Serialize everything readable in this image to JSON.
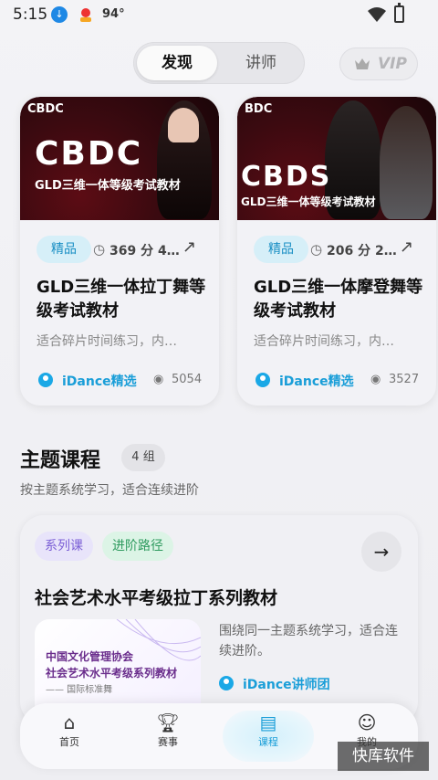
{
  "status": {
    "time": "5:15",
    "temp": "94°"
  },
  "tabs": {
    "active": "发现",
    "inactive": "讲师",
    "vip": "VIP"
  },
  "cards": [
    {
      "brand": "CBDC",
      "big_text": "CBDC",
      "image_subtitle": "GLD三维一体等级考试教材",
      "tag": "精品",
      "duration": "369 分 4…",
      "title": "GLD三维一体拉丁舞等级考试教材",
      "desc": "适合碎片时间练习，内…",
      "author": "iDance精选",
      "views": "5054"
    },
    {
      "brand": "BDC",
      "big_text": "CBDS",
      "image_subtitle": "GLD三维一体等级考试教材",
      "tag": "精品",
      "duration": "206 分 2…",
      "title": "GLD三维一体摩登舞等级考试教材",
      "desc": "适合碎片时间练习，内…",
      "author": "iDance精选",
      "views": "3527"
    }
  ],
  "section": {
    "title": "主题课程",
    "count": "4 组",
    "subtitle": "按主题系统学习，适合连续进阶"
  },
  "topic": {
    "chip1": "系列课",
    "chip2": "进阶路径",
    "title": "社会艺术水平考级拉丁系列教材",
    "img_line1": "中国文化管理协会",
    "img_line2": "社会艺术水平考级系列教材",
    "img_line3": "—— 国际标准舞",
    "desc": "围绕同一主题系统学习，适合连续进阶。",
    "author": "iDance讲师团"
  },
  "nav": [
    {
      "label": "首页",
      "icon": "home-icon"
    },
    {
      "label": "赛事",
      "icon": "trophy-icon"
    },
    {
      "label": "课程",
      "icon": "book-icon"
    },
    {
      "label": "我的",
      "icon": "person-icon"
    }
  ],
  "watermark": "快库软件",
  "colors": {
    "accent": "#1a9ed8",
    "tag_bg": "#d6eff8",
    "chip_purple": "#7b5fd6",
    "chip_green": "#2e9a5e"
  }
}
